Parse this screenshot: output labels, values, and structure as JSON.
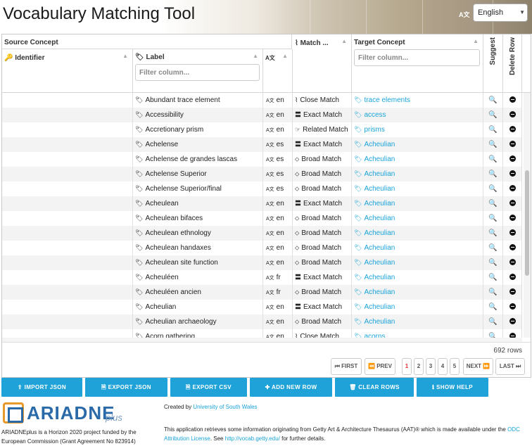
{
  "app": {
    "title": "Vocabulary Matching Tool",
    "language": "English",
    "lang_icon": "translate-icon"
  },
  "grid": {
    "headers": {
      "source": "Source Concept",
      "identifier": "Identifier",
      "label": "Label",
      "match": "Match ...",
      "target": "Target Concept",
      "suggest": "Suggest",
      "delete": "Delete Row"
    },
    "filter_placeholder": "Filter column...",
    "rows": [
      {
        "label": "Abundant trace element",
        "lang": "en",
        "match": "Close Match",
        "target": "trace elements"
      },
      {
        "label": "Accessibility",
        "lang": "en",
        "match": "Exact Match",
        "target": "access"
      },
      {
        "label": "Accretionary prism",
        "lang": "en",
        "match": "Related Match",
        "target": "prisms"
      },
      {
        "label": "Achelense",
        "lang": "es",
        "match": "Exact Match",
        "target": "Acheulian"
      },
      {
        "label": "Achelense de grandes lascas",
        "lang": "es",
        "match": "Broad Match",
        "target": "Acheulian"
      },
      {
        "label": "Achelense Superior",
        "lang": "es",
        "match": "Broad Match",
        "target": "Acheulian"
      },
      {
        "label": "Achelense Superior/final",
        "lang": "es",
        "match": "Broad Match",
        "target": "Acheulian"
      },
      {
        "label": "Acheulean",
        "lang": "en",
        "match": "Exact Match",
        "target": "Acheulian"
      },
      {
        "label": "Acheulean bifaces",
        "lang": "en",
        "match": "Broad Match",
        "target": "Acheulian"
      },
      {
        "label": "Acheulean ethnology",
        "lang": "en",
        "match": "Broad Match",
        "target": "Acheulian"
      },
      {
        "label": "Acheulean handaxes",
        "lang": "en",
        "match": "Broad Match",
        "target": "Acheulian"
      },
      {
        "label": "Acheulean site function",
        "lang": "en",
        "match": "Broad Match",
        "target": "Acheulian"
      },
      {
        "label": "Acheuléen",
        "lang": "fr",
        "match": "Exact Match",
        "target": "Acheulian"
      },
      {
        "label": "Acheuléen ancien",
        "lang": "fr",
        "match": "Broad Match",
        "target": "Acheulian"
      },
      {
        "label": "Acheulian",
        "lang": "en",
        "match": "Exact Match",
        "target": "Acheulian"
      },
      {
        "label": "Acheulian archaeology",
        "lang": "en",
        "match": "Broad Match",
        "target": "Acheulian"
      },
      {
        "label": "Acorn gathering",
        "lang": "en",
        "match": "Close Match",
        "target": "acorns"
      }
    ],
    "row_count": "692 rows",
    "pager": {
      "first": "FIRST",
      "prev": "PREV",
      "pages": [
        "1",
        "2",
        "3",
        "4",
        "5"
      ],
      "current": "1",
      "next": "NEXT",
      "last": "LAST"
    }
  },
  "actions": {
    "import": "IMPORT JSON",
    "export_json": "EXPORT JSON",
    "export_csv": "EXPORT CSV",
    "add_row": "ADD NEW ROW",
    "clear": "CLEAR ROWS",
    "help": "SHOW HELP"
  },
  "footer": {
    "logo": "ARIADNE",
    "logo_suffix": "plus",
    "funding": "ARIADNEplus is a Horizon 2020 project funded by the European Commission (Grant Agreement No 823914)",
    "created_prefix": "Created by",
    "created_by": "University of South Wales",
    "info_text": "This application retrieves some information originating from Getty Art & Architecture Thesaurus (AAT)® which is made available under the",
    "license": "ODC Attribution License",
    "see": ". See",
    "getty_url": "http://vocab.getty.edu/",
    "further": "for further details."
  },
  "colors": {
    "accent": "#1fa2d8",
    "link": "#1aa3d9",
    "danger": "#d33333"
  }
}
